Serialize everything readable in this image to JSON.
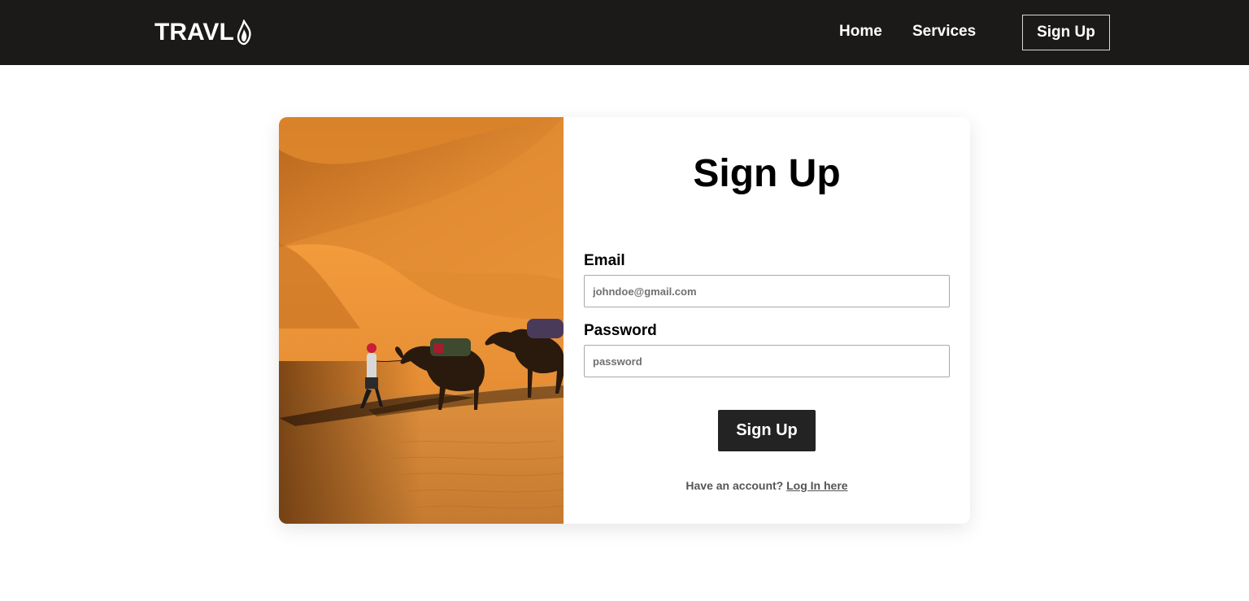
{
  "brand": {
    "name": "TRAVL"
  },
  "nav": {
    "home": "Home",
    "services": "Services",
    "signup": "Sign Up"
  },
  "form": {
    "title": "Sign Up",
    "email_label": "Email",
    "email_placeholder": "johndoe@gmail.com",
    "password_label": "Password",
    "password_placeholder": "password",
    "submit_label": "Sign Up",
    "account_prompt": "Have an account?",
    "login_link": "Log In here"
  },
  "icons": [
    "flame-logo-icon"
  ],
  "colors": {
    "navbar_bg": "#1c1a19",
    "button_bg": "#232323",
    "sand": "#e99433"
  }
}
